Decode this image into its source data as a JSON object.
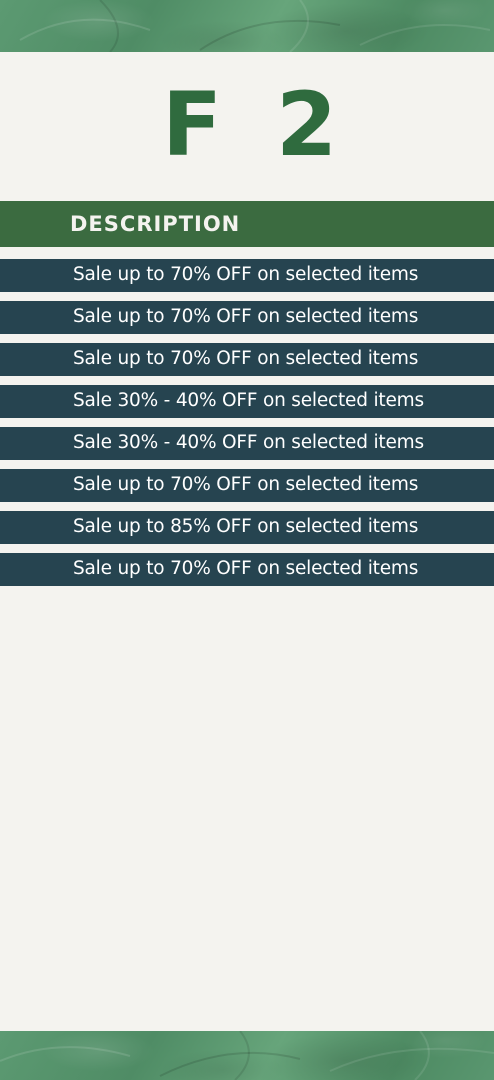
{
  "floor": {
    "letter": "F",
    "number": "2"
  },
  "description": {
    "header": "DESCRIPTION",
    "rows": [
      "Sale up to 70% OFF on selected items",
      "Sale up to 70% OFF on selected items",
      "Sale up to 70% OFF on selected items",
      "Sale 30% - 40% OFF on selected items",
      "Sale 30% - 40% OFF on selected items",
      "Sale up to 70% OFF on selected items",
      "Sale up to 85% OFF on selected items",
      "Sale up to 70% OFF on selected items"
    ]
  },
  "colors": {
    "background": "#f4f3ef",
    "floor_text": "#2f6b3e",
    "header_band": "#3b6b40",
    "row_band": "#264450",
    "leaf_band": "#5a9770"
  }
}
